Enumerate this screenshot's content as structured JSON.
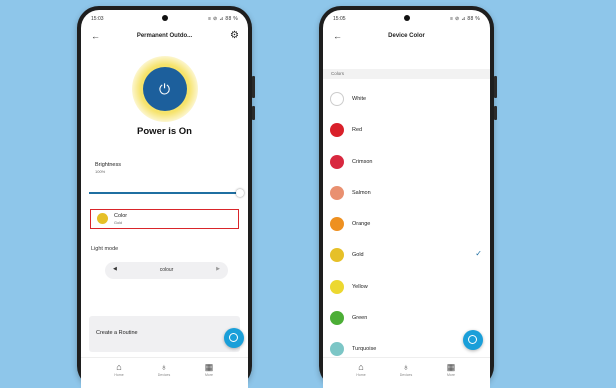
{
  "phone1": {
    "status": {
      "time": "15:03",
      "icons": "≡ ⊘ ⊿ 88 %"
    },
    "title": "Permanent Outdo...",
    "power_status": "Power is On",
    "brightness": {
      "label": "Brightness",
      "value": "100%",
      "level": 1.0
    },
    "color": {
      "label": "Color",
      "value": "Gold",
      "swatch": "#e6c028"
    },
    "light_mode": {
      "label": "Light mode",
      "value": "colour"
    },
    "routine": {
      "label": "Create a Routine"
    },
    "nav": [
      {
        "label": "Home",
        "icon": "home-icon"
      },
      {
        "label": "Devices",
        "icon": "lightbulb-icon"
      },
      {
        "label": "More",
        "icon": "grid-icon"
      }
    ]
  },
  "phone2": {
    "status": {
      "time": "15:05",
      "icons": "≡ ⊘ ⊿ 88 %"
    },
    "title": "Device Color",
    "section": "Colors",
    "colors": [
      {
        "name": "White",
        "hex": "#ffffff"
      },
      {
        "name": "Red",
        "hex": "#d9202a"
      },
      {
        "name": "Crimson",
        "hex": "#d8283f"
      },
      {
        "name": "Salmon",
        "hex": "#e99070"
      },
      {
        "name": "Orange",
        "hex": "#ee9020"
      },
      {
        "name": "Gold",
        "hex": "#e6c028"
      },
      {
        "name": "Yellow",
        "hex": "#ecd830"
      },
      {
        "name": "Green",
        "hex": "#4cae36"
      },
      {
        "name": "Turquoise",
        "hex": "#7cc6c6"
      }
    ],
    "selected": "Gold",
    "nav": [
      {
        "label": "Home",
        "icon": "home-icon"
      },
      {
        "label": "Devices",
        "icon": "lightbulb-icon"
      },
      {
        "label": "More",
        "icon": "grid-icon"
      }
    ]
  },
  "colors": {
    "background": "#8ec6ea",
    "accent": "#1f6fa1",
    "highlight": "#d9252a",
    "fab": "#1a9fd9"
  }
}
